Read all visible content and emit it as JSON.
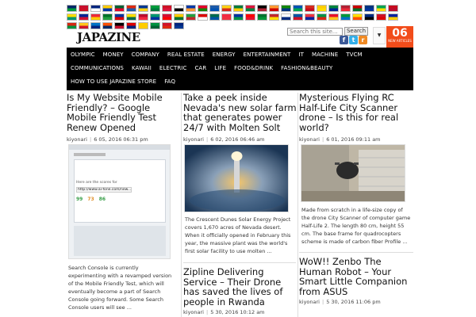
{
  "flags": [
    "#002868",
    "#c8102e",
    "#00247d",
    "#ffcc00",
    "#006233",
    "#de2910",
    "#003893",
    "#009c3b",
    "#ce1126",
    "#ffffff",
    "#0038a8",
    "#e4002b",
    "#1d5aa8",
    "#fcd116",
    "#007a3d",
    "#dc143c",
    "#000000",
    "#ff9933",
    "#138808",
    "#0052b4",
    "#d52b1e",
    "#ffcd00",
    "#00843d",
    "#b22234",
    "#cc0000",
    "#003580",
    "#00a550",
    "#c60b1e",
    "#ffde00",
    "#002395",
    "#ed2939",
    "#007229",
    "#0033a0",
    "#fedf00",
    "#ba0c2f",
    "#00966e",
    "#d21034",
    "#fecb00",
    "#239f40",
    "#da0000",
    "#006a4e",
    "#f42a41",
    "#0032a0",
    "#ff0000",
    "#00732f",
    "#c1272d",
    "#ffffff",
    "#0055a4",
    "#ef3340",
    "#009246",
    "#e8112d",
    "#009739",
    "#fedd00",
    "#002b7f",
    "#ce1126",
    "#00209f",
    "#d62612",
    "#ffc61e",
    "#0072c6",
    "#ff4f00",
    "#000000",
    "#dd0000",
    "#ffce00",
    "#00923f",
    "#cf142b",
    "#00247d"
  ],
  "logo": {
    "text": "JAPAZINE"
  },
  "search": {
    "placeholder": "Search this site...",
    "button_label": "Search"
  },
  "social": {
    "facebook": "f",
    "twitter": "t",
    "rss": "r"
  },
  "date_badge": {
    "day": "06",
    "label": "NEW ARTICLES"
  },
  "nav": {
    "row1": [
      "OLYMPIC",
      "MONEY",
      "COMPANY",
      "REAL ESTATE",
      "ENERGY",
      "ENTERTAINMENT",
      "IT",
      "MACHINE",
      "TVCM"
    ],
    "row2": [
      "COMMUNICATIONS",
      "KAWAII",
      "ELECTRIC",
      "CAR",
      "LIFE",
      "FOOD&DRINK",
      "FASHION&BEAUTY"
    ],
    "row3": [
      "HOW TO USE JAPAZINE STORE",
      "FAQ"
    ]
  },
  "posts": [
    {
      "title": "Is My Website Mobile Friendly? – Google Mobile Friendly Test Renew Opened",
      "author": "kiyonari",
      "date": "6 05, 2016 06:31 pm",
      "excerpt": "Search Console is currently experimenting with a revamped version of the Mobile Friendly Test, which will eventually become a part of Search Console going forward. Some Search Console users will see ...",
      "thumb": {
        "url_text": "http://www.ai-fone.com/new...",
        "heading": "Here are the scores for",
        "scores": [
          "99",
          "73",
          "86"
        ]
      }
    },
    {
      "title": "Take a peek inside Nevada's new solar farm that generates power 24/7 with Molten Solt",
      "author": "kiyonari",
      "date": "6 02, 2016 06:46 am",
      "excerpt": "The Crescent Dunes Solar Energy Project covers 1,670 acres of Nevada desert. When it officially opened in February this year, the massive plant was the world's first solar facility to use molten ..."
    },
    {
      "title": "Mysterious Flying RC Half-Life City Scanner drone – Is this for real world?",
      "author": "kiyonari",
      "date": "6 01, 2016 09:11 am",
      "excerpt": "Made from scratch in a life-size copy of the drone City Scanner of computer game Half-Life 2. The length 80 cm, height 55 cm. The base frame for quadrocopters scheme is made of carbon fiber Profile ..."
    },
    {
      "title": "Zipline Delivering Service – Their Drone has saved the lives of people in Rwanda",
      "author": "kiyonari",
      "date": "5 30, 2016 10:12 am"
    },
    {
      "title": "WoW!! Zenbo The Human Robot – Your Smart Little Companion from ASUS",
      "author": "kiyonari",
      "date": "5 30, 2016 11:06 pm"
    }
  ]
}
